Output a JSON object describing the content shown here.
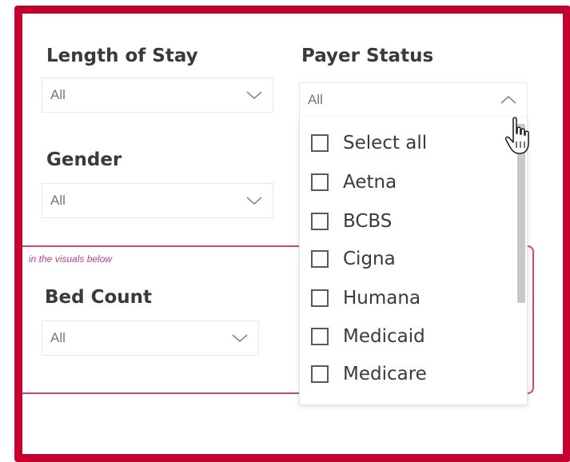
{
  "filters": {
    "length_of_stay": {
      "label": "Length of Stay",
      "value": "All"
    },
    "payer_status": {
      "label": "Payer Status",
      "value": "All"
    },
    "gender": {
      "label": "Gender",
      "value": "All"
    },
    "bed_count": {
      "label": "Bed Count",
      "value": "All"
    }
  },
  "note": "in the visuals below",
  "payer_options": {
    "items": [
      "Select all",
      "Aetna",
      "BCBS",
      "Cigna",
      "Humana",
      "Medicaid",
      "Medicare"
    ]
  },
  "colors": {
    "frame": "#c3002f",
    "highlight": "#d1457c"
  },
  "icons": {
    "dropdown": "chevron-down-icon",
    "open_dropdown": "chevron-up-icon",
    "pointer": "hand-pointer-icon"
  }
}
